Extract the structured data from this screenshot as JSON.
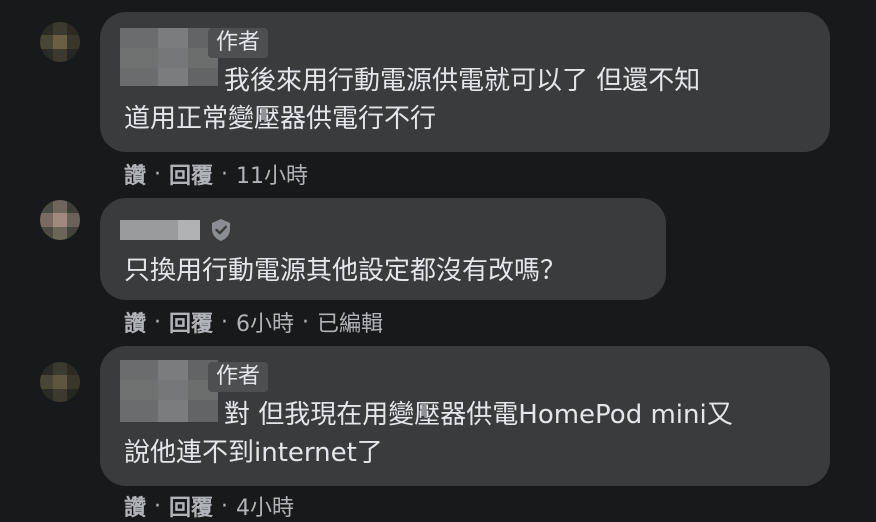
{
  "comments": [
    {
      "author_badge": "作者",
      "text_line1": "我後來用行動電源供電就可以了 但還不知",
      "text_line2": "道用正常變壓器供電行不行",
      "actions": {
        "like": "讚",
        "reply": "回覆",
        "time": "11小時"
      }
    },
    {
      "text_line1": "只換用行動電源其他設定都沒有改嗎？",
      "actions": {
        "like": "讚",
        "reply": "回覆",
        "time": "6小時",
        "edited": "已編輯"
      }
    },
    {
      "author_badge": "作者",
      "text_line1": "對 但我現在用變壓器供電HomePod mini又",
      "text_line2": "說他連不到internet了",
      "actions": {
        "like": "讚",
        "reply": "回覆",
        "time": "4小時"
      }
    }
  ],
  "separator": "·",
  "icons": {
    "verified": "shield-check-icon"
  },
  "colors": {
    "background": "#18191a",
    "bubble": "#3a3b3c",
    "text": "#e4e6eb",
    "secondary": "#b0b3b8"
  }
}
